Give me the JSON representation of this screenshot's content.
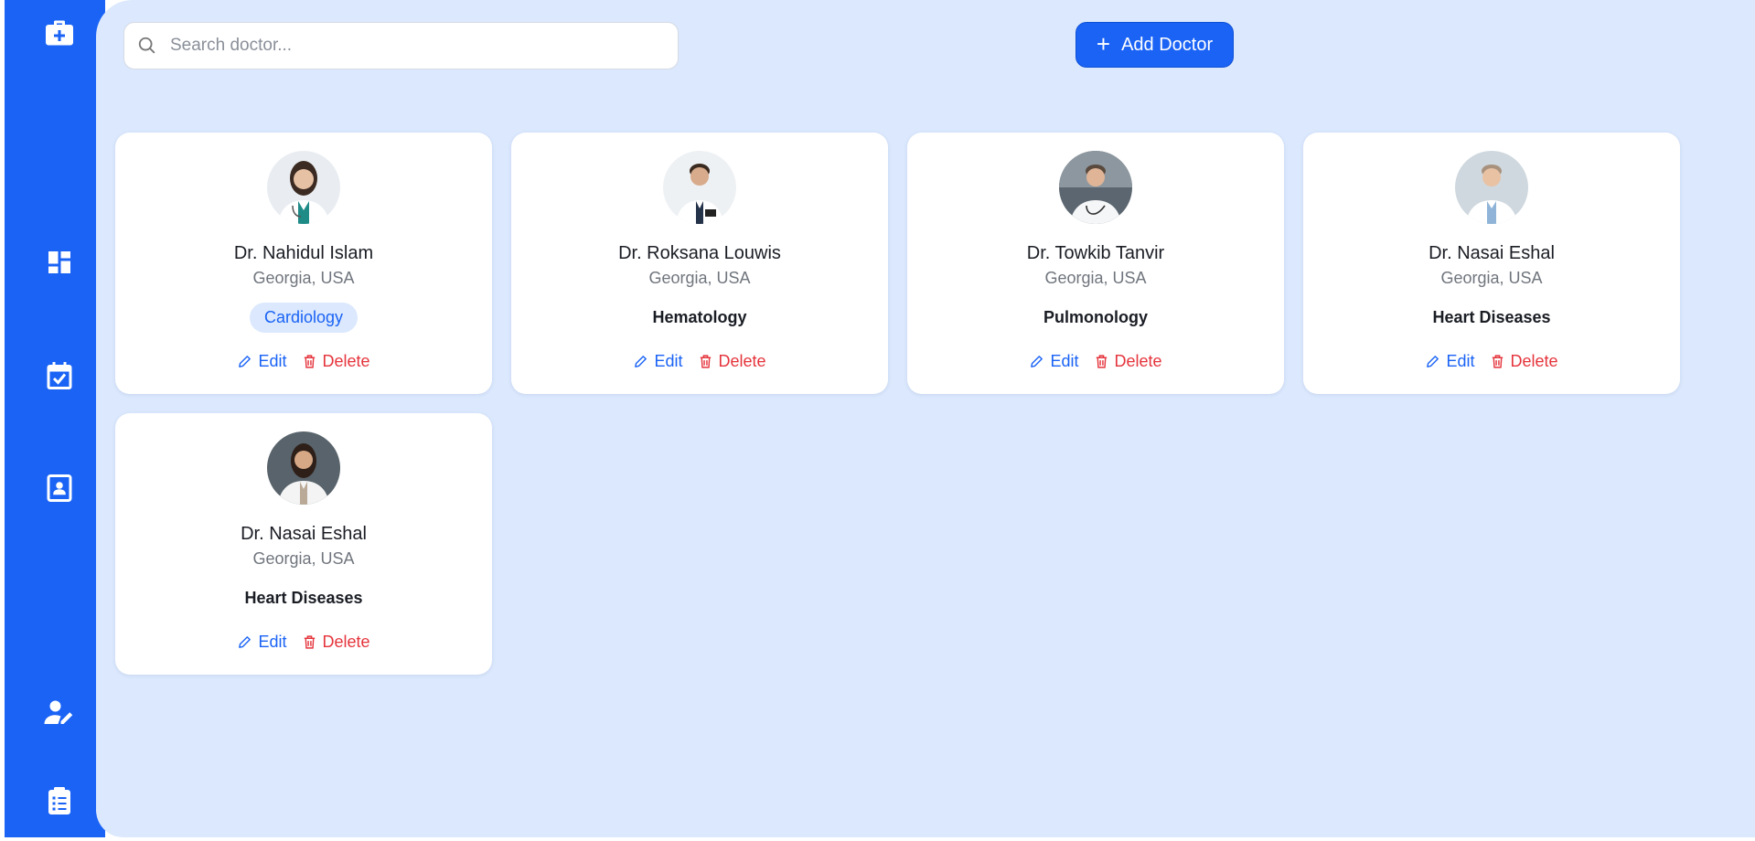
{
  "sidebar": {
    "items": [
      {
        "icon": "medical-kit-icon"
      },
      {
        "icon": "dashboard-icon"
      },
      {
        "icon": "calendar-check-icon"
      },
      {
        "icon": "contact-card-icon"
      },
      {
        "icon": "user-edit-icon"
      },
      {
        "icon": "clipboard-list-icon"
      }
    ]
  },
  "search": {
    "placeholder": "Search doctor..."
  },
  "toolbar": {
    "add_label": "Add Doctor"
  },
  "doctors": [
    {
      "name": "Dr. Nahidul Islam",
      "location": "Georgia, USA",
      "specialty": "Cardiology",
      "active": true,
      "edit": "Edit",
      "delete": "Delete"
    },
    {
      "name": "Dr. Roksana Louwis",
      "location": "Georgia, USA",
      "specialty": "Hematology",
      "active": false,
      "edit": "Edit",
      "delete": "Delete"
    },
    {
      "name": "Dr. Towkib Tanvir",
      "location": "Georgia, USA",
      "specialty": "Pulmonology",
      "active": false,
      "edit": "Edit",
      "delete": "Delete"
    },
    {
      "name": "Dr. Nasai Eshal",
      "location": "Georgia, USA",
      "specialty": "Heart Diseases",
      "active": false,
      "edit": "Edit",
      "delete": "Delete"
    },
    {
      "name": "Dr. Nasai Eshal",
      "location": "Georgia, USA",
      "specialty": "Heart Diseases",
      "active": false,
      "edit": "Edit",
      "delete": "Delete"
    }
  ],
  "colors": {
    "accent": "#1a63f5",
    "background": "#dbe8fd",
    "danger": "#e5343c"
  }
}
